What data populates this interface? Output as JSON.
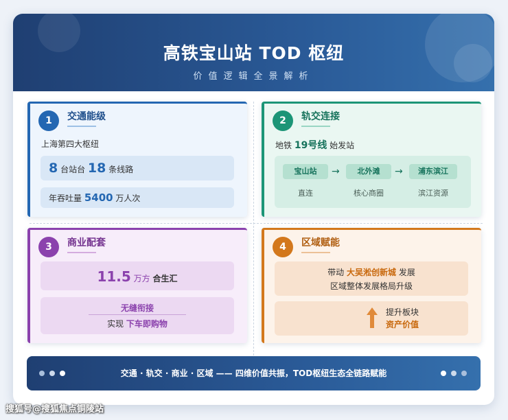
{
  "header": {
    "title": "高铁宝山站 TOD 枢纽",
    "subtitle": "价值逻辑全景解析"
  },
  "panels": [
    {
      "number": "1",
      "title": "交通能级",
      "line": "上海第四大枢纽",
      "stat": {
        "a_num": "8",
        "a_unit": "台站台",
        "b_num": "18",
        "b_unit": "条线路"
      },
      "throughput": {
        "prefix": "年吞吐量",
        "num": "5400",
        "unit": "万人次"
      }
    },
    {
      "number": "2",
      "title": "轨交连接",
      "metro": {
        "prefix": "地铁",
        "line": "19号线",
        "suffix": "始发站"
      },
      "stations": [
        {
          "name": "宝山站",
          "label": "直连"
        },
        {
          "name": "北外滩",
          "label": "核心商圈"
        },
        {
          "name": "浦东滨江",
          "label": "滨江资源"
        }
      ],
      "arrow": "→"
    },
    {
      "number": "3",
      "title": "商业配套",
      "area": {
        "num": "11.5",
        "unit": "万方",
        "name": "合生汇"
      },
      "seamless": {
        "head": "无缝衔接",
        "prefix": "实现",
        "highlight": "下车即购物"
      }
    },
    {
      "number": "4",
      "title": "区域赋能",
      "drive": {
        "prefix": "带动",
        "highlight": "大吴淞创新城",
        "suffix": "发展",
        "line2": "区域整体发展格局升级"
      },
      "value": {
        "line1": "提升板块",
        "line2": "资产价值"
      }
    }
  ],
  "footer": {
    "text": "交通 · 轨交 · 商业 · 区域 —— 四维价值共振，TOD枢纽生态全链路赋能"
  },
  "watermark": "搜狐号@搜狐焦点铜陵站",
  "colors": {
    "header_bg": "#2a5a97",
    "blue": "#2467b2",
    "teal": "#1c9577",
    "purple": "#8b42ad",
    "orange": "#d3781c"
  }
}
